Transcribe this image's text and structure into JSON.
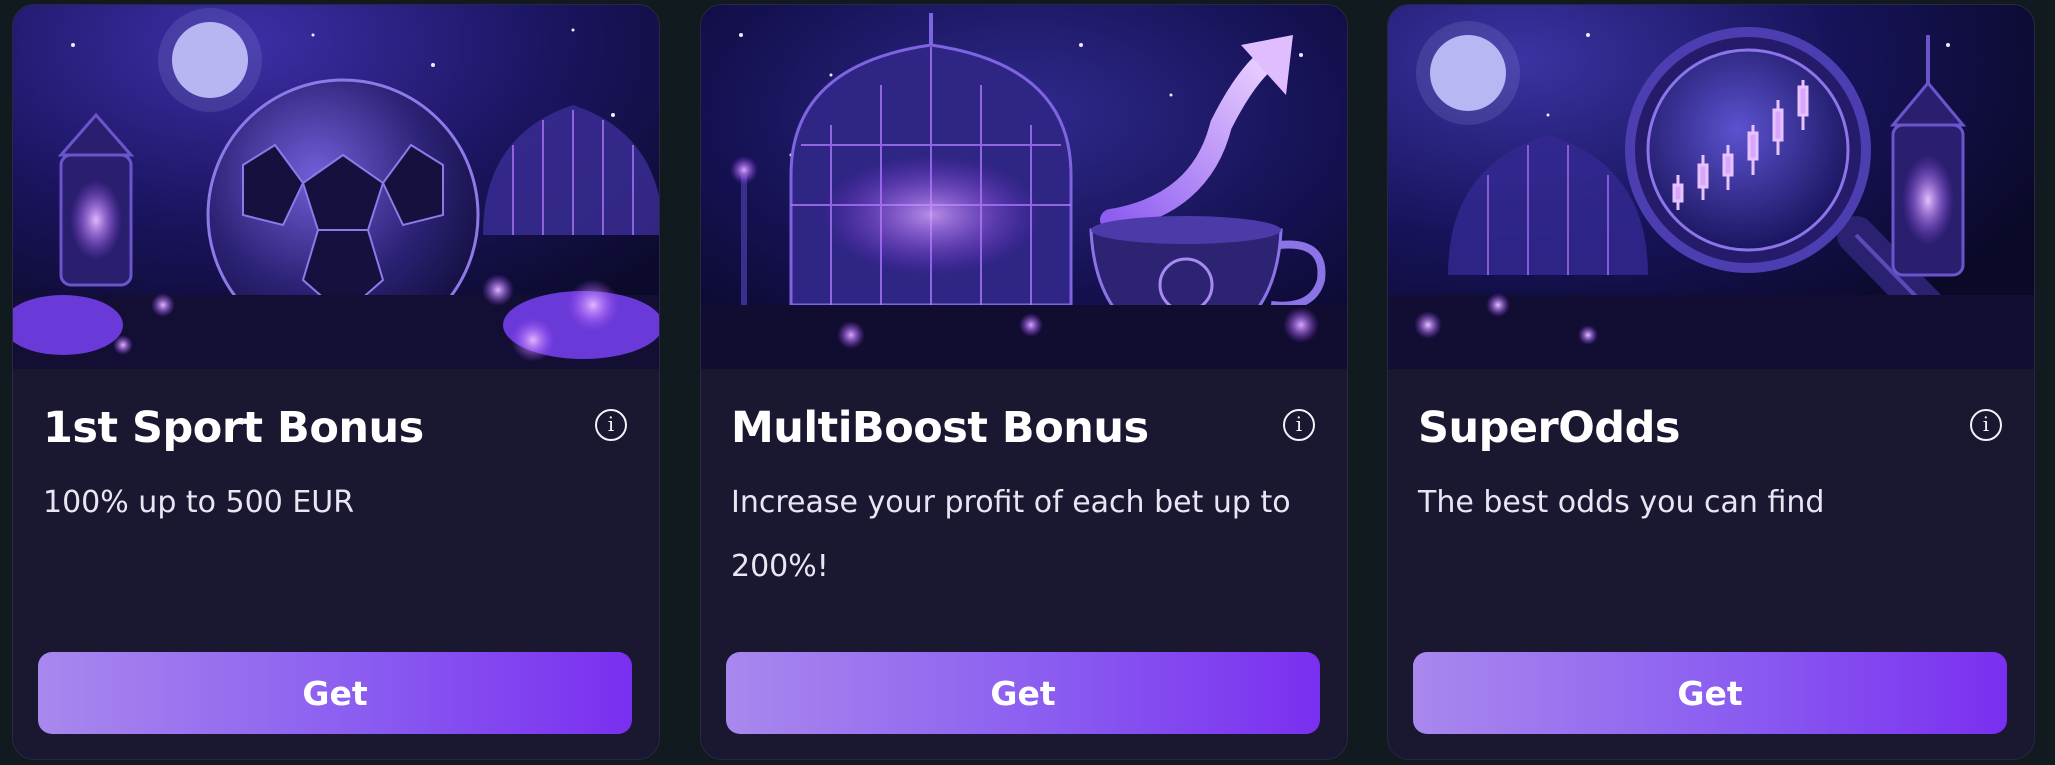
{
  "cards": [
    {
      "title": "1st Sport Bonus",
      "description": "100% up to 500 EUR",
      "button_label": "Get",
      "info_icon": "info-icon",
      "image": "football-moonlit-garden"
    },
    {
      "title": "MultiBoost Bonus",
      "description": "Increase your profit of each bet up to 200%!",
      "button_label": "Get",
      "info_icon": "info-icon",
      "image": "greenhouse-teacup-arrow"
    },
    {
      "title": "SuperOdds",
      "description": "The best odds you can find",
      "button_label": "Get",
      "info_icon": "info-icon",
      "image": "magnifier-chart-garden"
    }
  ],
  "colors": {
    "page_background": "#101a1f",
    "card_background": "#1a1730",
    "button_gradient_start": "#a988ee",
    "button_gradient_end": "#7a2ff0",
    "text_primary": "#ffffff"
  }
}
